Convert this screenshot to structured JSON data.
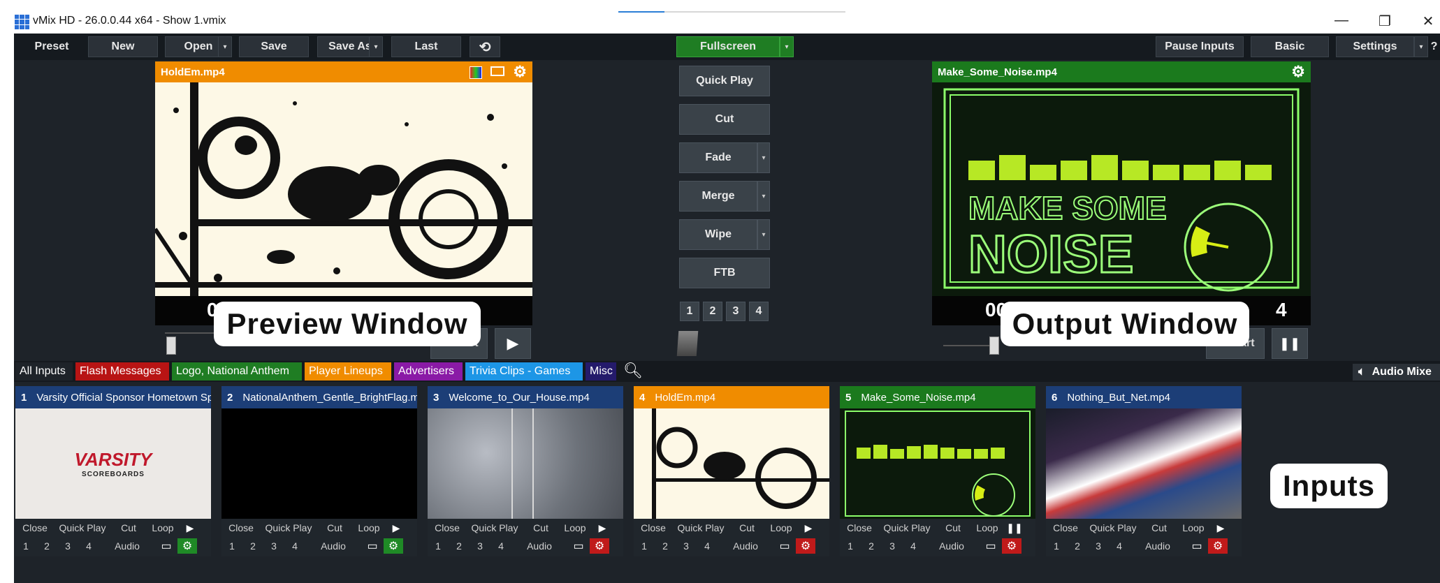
{
  "window": {
    "title": "vMix HD - 26.0.0.44 x64 - Show 1.vmix",
    "minimize_glyph": "—",
    "restore_glyph": "❐",
    "close_glyph": "✕"
  },
  "toolbar": {
    "preset": "Preset",
    "new": "New",
    "open": "Open",
    "save": "Save",
    "save_as": "Save As",
    "last": "Last",
    "fullscreen": "Fullscreen",
    "pause_inputs": "Pause Inputs",
    "basic": "Basic",
    "settings": "Settings",
    "help": "?",
    "caret": "▾",
    "reload_icon": "⟲"
  },
  "preview": {
    "filename": "HoldEm.mp4",
    "time_fragment": "0",
    "restart_label": "Restart",
    "play_icon": "▶",
    "callout": "Preview Window"
  },
  "output": {
    "filename": "Make_Some_Noise.mp4",
    "time_fragment_left": "00",
    "time_fragment_right": "4",
    "restart_label": "Restart",
    "pause_icon": "❚❚",
    "callout": "Output Window",
    "art_text_line1": "MAKE SOME",
    "art_text_line2": "NOISE"
  },
  "transitions": {
    "quick_play": "Quick Play",
    "cut": "Cut",
    "fade": "Fade",
    "merge": "Merge",
    "wipe": "Wipe",
    "ftb": "FTB",
    "numbers": [
      "1",
      "2",
      "3",
      "4"
    ]
  },
  "tabs": [
    {
      "label": "All Inputs",
      "bg": "#1e2329"
    },
    {
      "label": "Flash Messages",
      "bg": "#b81414"
    },
    {
      "label": "Logo, National Anthem",
      "bg": "#1f7d23"
    },
    {
      "label": "Player Lineups",
      "bg": "#f08c00"
    },
    {
      "label": "Advertisers",
      "bg": "#8a1aa6"
    },
    {
      "label": "Trivia Clips - Games",
      "bg": "#1d96e6"
    },
    {
      "label": "Misc",
      "bg": "#241a6b"
    }
  ],
  "audio_mixer": "Audio Mixe",
  "inputs_callout": "Inputs",
  "inputs": [
    {
      "num": "1",
      "name": "Varsity Official Sponsor Hometown Sp",
      "head": "#1c3e77",
      "gear": "#1f8a26",
      "state": "▶"
    },
    {
      "num": "2",
      "name": "NationalAnthem_Gentle_BrightFlag.mp",
      "head": "#1c3e77",
      "gear": "#1f8a26",
      "state": "▶"
    },
    {
      "num": "3",
      "name": "Welcome_to_Our_House.mp4",
      "head": "#1c3e77",
      "gear": "#c01a1a",
      "state": "▶"
    },
    {
      "num": "4",
      "name": "HoldEm.mp4",
      "head": "#f08c00",
      "gear": "#c01a1a",
      "state": "▶"
    },
    {
      "num": "5",
      "name": "Make_Some_Noise.mp4",
      "head": "#1b7a1d",
      "gear": "#c01a1a",
      "state": "❚❚"
    },
    {
      "num": "6",
      "name": "Nothing_But_Net.mp4",
      "head": "#1c3e77",
      "gear": "#c01a1a",
      "state": "▶"
    }
  ],
  "tile_controls": {
    "close": "Close",
    "quick_play": "Quick Play",
    "cut": "Cut",
    "loop": "Loop",
    "n1": "1",
    "n2": "2",
    "n3": "3",
    "n4": "4",
    "audio": "Audio"
  },
  "varsity_logo": {
    "line1": "VARSITY",
    "line2": "SCOREBOARDS"
  }
}
